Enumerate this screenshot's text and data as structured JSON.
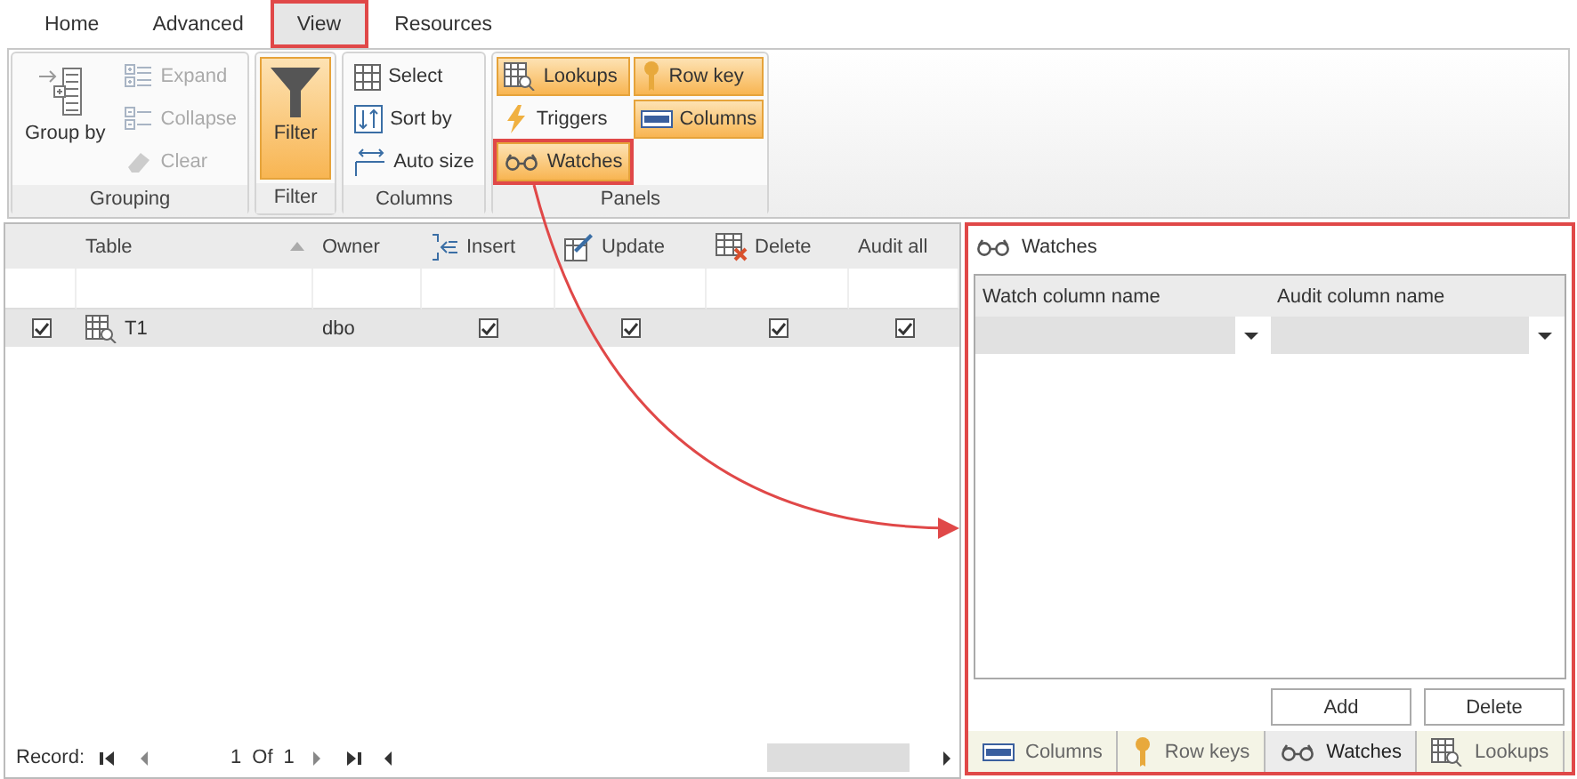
{
  "ribbon_tabs": [
    {
      "label": "Home",
      "selected": false,
      "highlighted": false
    },
    {
      "label": "Advanced",
      "selected": false,
      "highlighted": false
    },
    {
      "label": "View",
      "selected": true,
      "highlighted": true
    },
    {
      "label": "Resources",
      "selected": false,
      "highlighted": false
    }
  ],
  "ribbon_groups": [
    {
      "label": "Grouping",
      "items": [
        {
          "label": "Group by",
          "kind": "large",
          "active": false,
          "disabled": false,
          "highlighted": false
        },
        {
          "label": "Expand",
          "kind": "small",
          "active": false,
          "disabled": true,
          "highlighted": false
        },
        {
          "label": "Collapse",
          "kind": "small",
          "active": false,
          "disabled": true,
          "highlighted": false
        },
        {
          "label": "Clear",
          "kind": "small",
          "active": false,
          "disabled": true,
          "highlighted": false
        }
      ]
    },
    {
      "label": "Filter",
      "items": [
        {
          "label": "Filter",
          "kind": "large",
          "active": true,
          "disabled": false,
          "highlighted": false
        }
      ]
    },
    {
      "label": "Columns",
      "items": [
        {
          "label": "Select",
          "kind": "small",
          "active": false,
          "disabled": false,
          "highlighted": false
        },
        {
          "label": "Sort by",
          "kind": "small",
          "active": false,
          "disabled": false,
          "highlighted": false
        },
        {
          "label": "Auto size",
          "kind": "small",
          "active": false,
          "disabled": false,
          "highlighted": false
        }
      ]
    },
    {
      "label": "Panels",
      "items": [
        {
          "label": "Lookups",
          "kind": "small",
          "active": true,
          "disabled": false,
          "highlighted": false
        },
        {
          "label": "Triggers",
          "kind": "small",
          "active": false,
          "disabled": false,
          "highlighted": false
        },
        {
          "label": "Watches",
          "kind": "small",
          "active": true,
          "disabled": false,
          "highlighted": true
        },
        {
          "label": "Row key",
          "kind": "small",
          "active": true,
          "disabled": false,
          "highlighted": false
        },
        {
          "label": "Columns",
          "kind": "small",
          "active": true,
          "disabled": false,
          "highlighted": false
        }
      ]
    }
  ],
  "grid": {
    "columns": [
      {
        "sorted": false
      },
      {
        "label": "Table",
        "sorted": true
      },
      {
        "label": "Owner",
        "sorted": false
      },
      {
        "label": "Insert",
        "sorted": false
      },
      {
        "label": "Update",
        "sorted": false
      },
      {
        "label": "Delete",
        "sorted": false
      },
      {
        "label": "Audit all",
        "sorted": false
      }
    ],
    "rows": [
      {
        "selected": true,
        "checked": true,
        "table": "T1",
        "owner": "dbo",
        "insert": true,
        "update": true,
        "delete": true,
        "audit_all": true
      }
    ],
    "navigator": {
      "label": "Record:",
      "current": "1",
      "of": "Of",
      "total": "1"
    }
  },
  "watches_panel": {
    "title": "Watches",
    "highlighted": true,
    "columns": [
      "Watch column name",
      "Audit column name"
    ],
    "buttons": [
      "Add",
      "Delete"
    ],
    "tabs": [
      {
        "label": "Columns",
        "selected": false
      },
      {
        "label": "Row keys",
        "selected": false
      },
      {
        "label": "Watches",
        "selected": true
      },
      {
        "label": "Lookups",
        "selected": false
      }
    ]
  }
}
